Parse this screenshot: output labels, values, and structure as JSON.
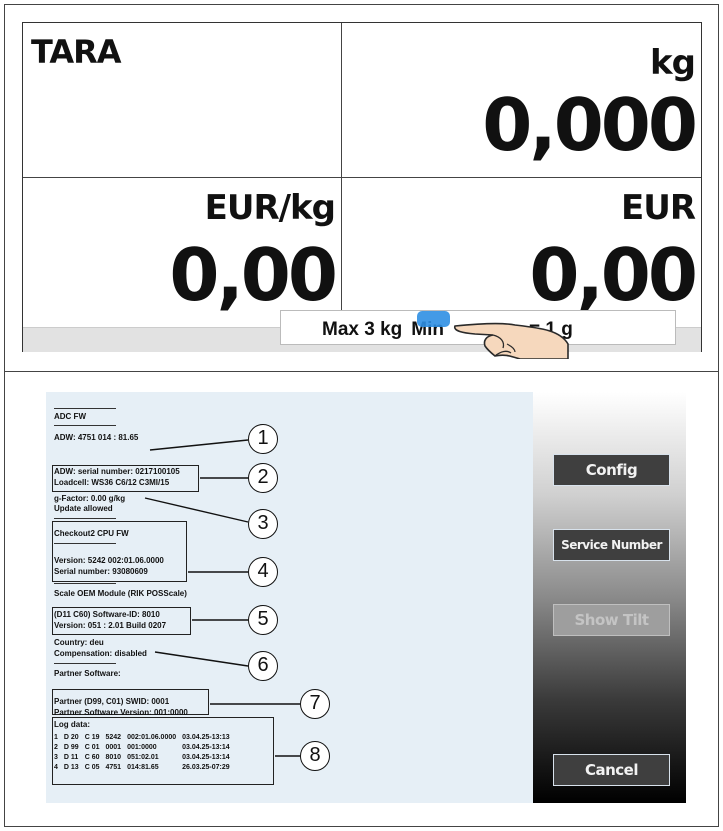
{
  "scale_display": {
    "tara_label": "TARA",
    "weight_unit": "kg",
    "weight_value": "0,000",
    "unit_price_unit": "EUR/kg",
    "unit_price_value": "0,00",
    "total_unit": "EUR",
    "total_value": "0,00",
    "status_max": "Max 3 kg",
    "status_min": "Min",
    "status_e": "= 1 g"
  },
  "info": {
    "adc_fw_title": "ADC FW",
    "adw_line": "ADW: 4751 014 : 81.65",
    "adw_serial": "ADW: serial number: 0217100105",
    "loadcell": "Loadcell: WS36 C6/12 C3MI/15",
    "g_factor": "g-Factor: 0.00 g/kg",
    "update_allowed": "Update allowed",
    "checkout_title": "Checkout2 CPU FW",
    "version_line": "Version: 5242 002:01.06.0000",
    "serial_line": "Serial number: 93080609",
    "oem_module": "Scale OEM Module (RIK POSScale)",
    "software_id": "(D11 C60) Software-ID: 8010",
    "version_build": "Version: 051 : 2.01 Build 0207",
    "country": "Country: deu",
    "compensation": "Compensation: disabled",
    "partner_software": "Partner Software:",
    "partner_swid": "Partner (D99, C01) SWID: 0001",
    "partner_version": "Partner Software Version: 001:0000",
    "log_title": "Log data:",
    "log_rows": [
      [
        "1",
        "D 20",
        "C 19",
        "5242",
        "002:01.06.0000",
        "03.04.25-13:13"
      ],
      [
        "2",
        "D 99",
        "C 01",
        "0001",
        "001:0000",
        "03.04.25-13:14"
      ],
      [
        "3",
        "D 11",
        "C 60",
        "8010",
        "051:02.01",
        "03.04.25-13:14"
      ],
      [
        "4",
        "D 13",
        "C 05",
        "4751",
        "014:81.65",
        "26.03.25-07:29"
      ]
    ]
  },
  "callouts": [
    "1",
    "2",
    "3",
    "4",
    "5",
    "6",
    "7",
    "8"
  ],
  "buttons": {
    "config": "Config",
    "service_number": "Service Number",
    "show_tilt": "Show Tilt",
    "cancel": "Cancel"
  },
  "colors": {
    "touch_indicator": "#2f8fe3",
    "info_background": "#e6eff6",
    "button_background": "#3f3f3f"
  },
  "icons": {
    "touch": "pointing-hand-icon"
  }
}
